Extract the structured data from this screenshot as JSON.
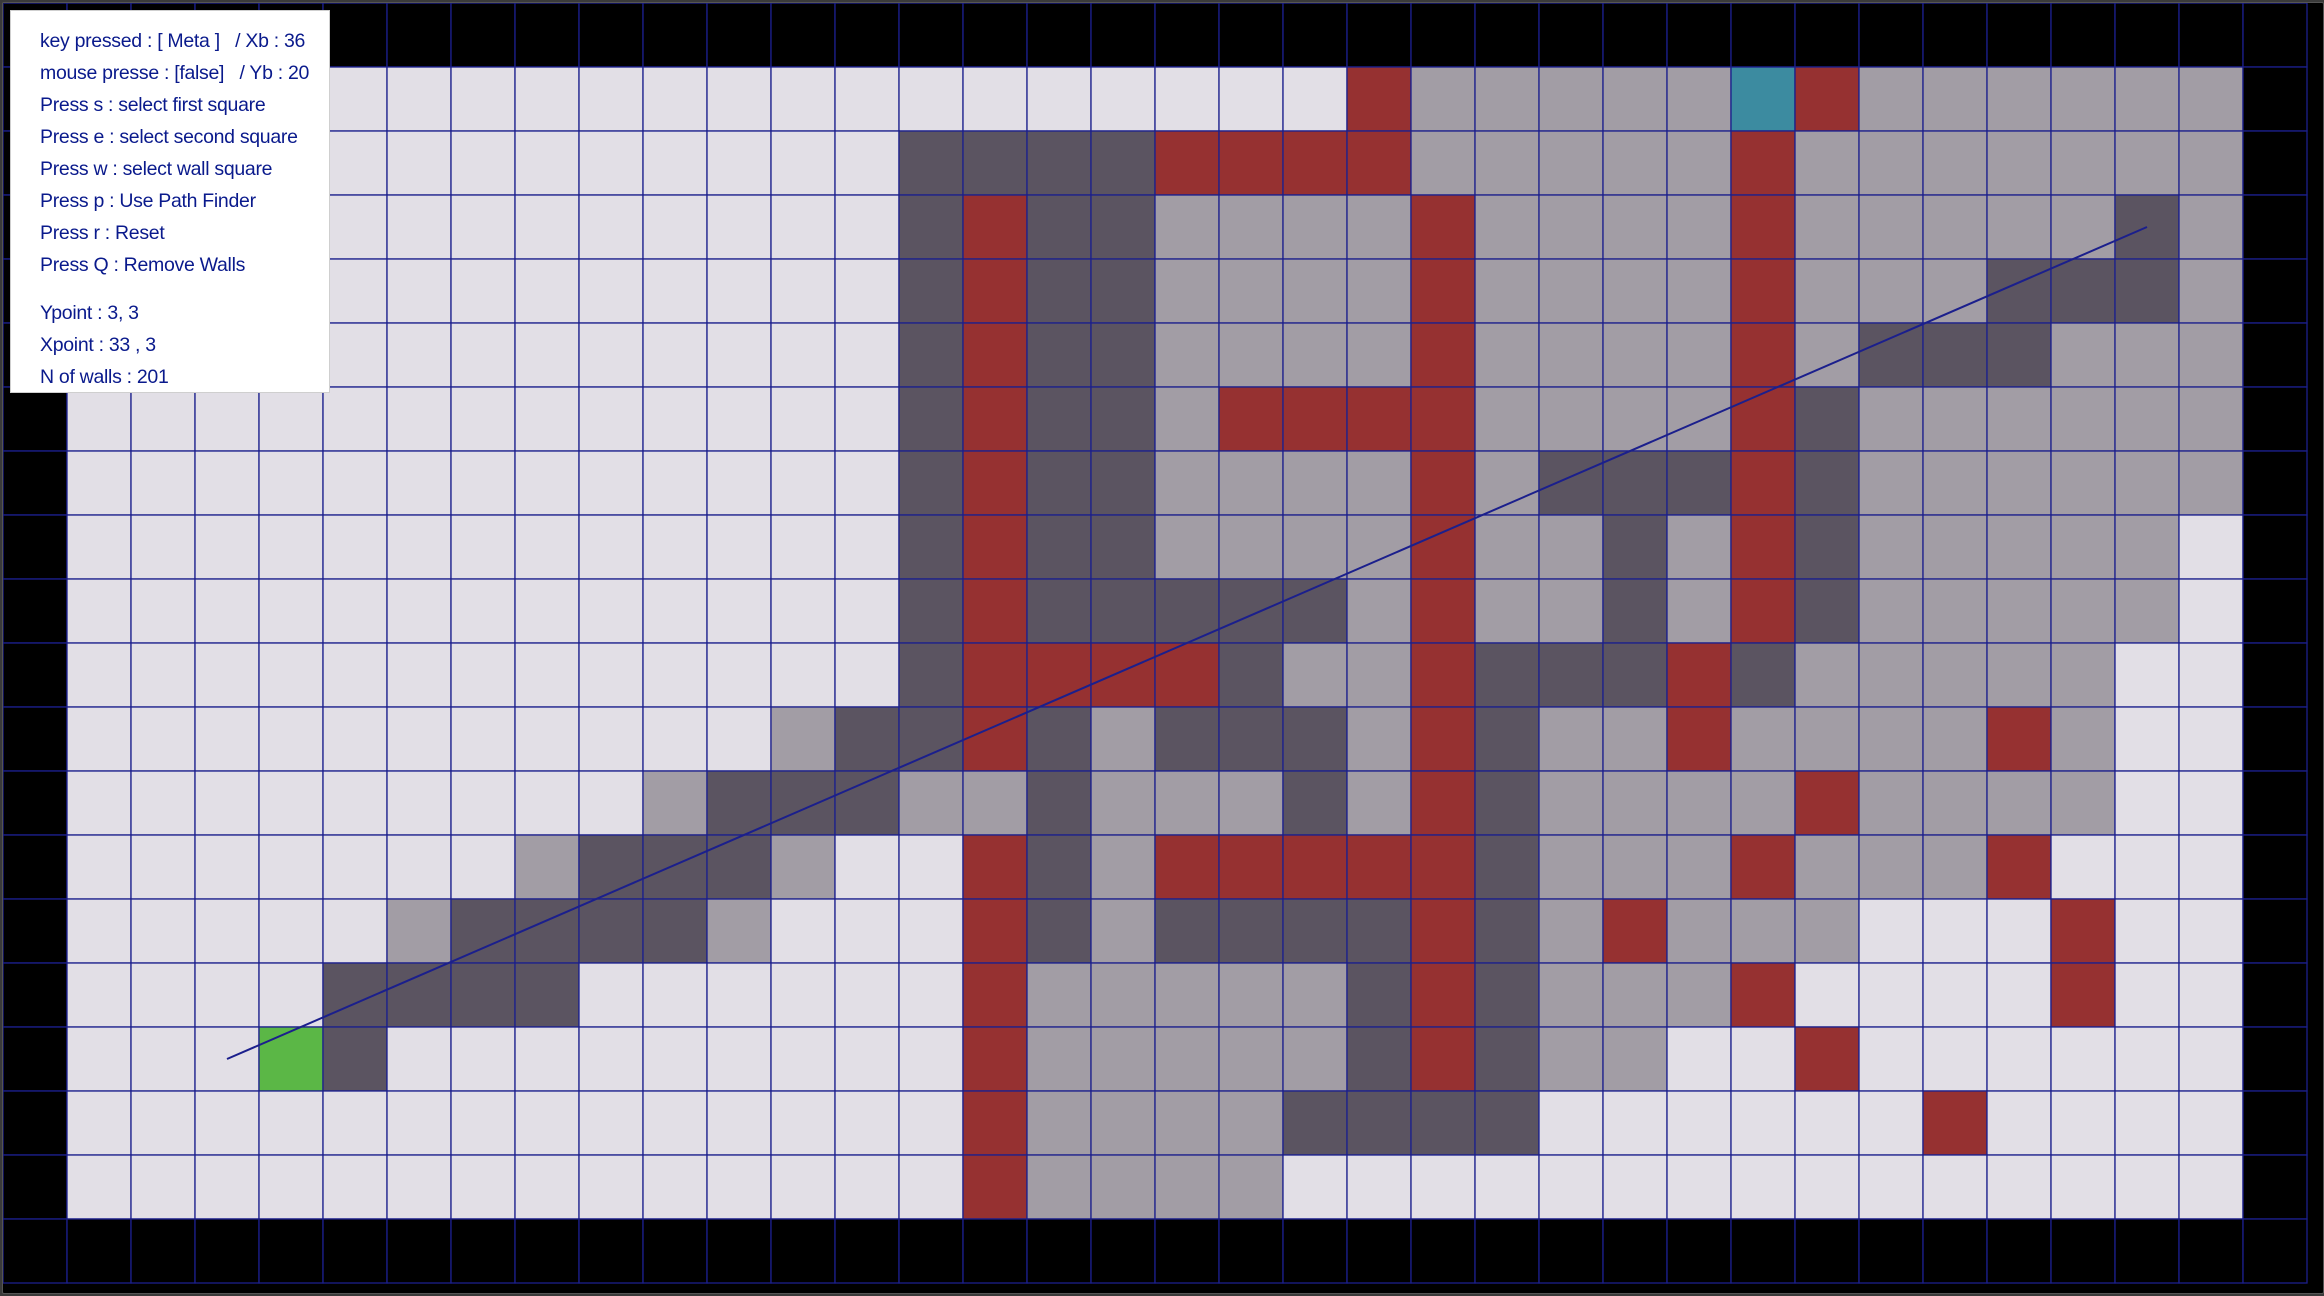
{
  "colors": {
    "outside": "#000000",
    "empty": "#e2dfe6",
    "wall": "#963131",
    "visited": "#a29da5",
    "path": "#5b5461",
    "start": "#5bb746",
    "end": "#3c8ba0",
    "gridline": "#1b1f8c",
    "sightline": "#1b1f8c"
  },
  "hud": {
    "key_pressed": "key pressed : [ Meta ]   / Xb : 36",
    "mouse_pressed": "mouse presse : [false]   / Yb : 20",
    "help_s": "Press s : select first square",
    "help_e": "Press e : select second square",
    "help_w": "Press w : select wall square",
    "help_p": "Press p : Use Path Finder",
    "help_r": "Press r : Reset",
    "help_q": "Press Q : Remove Walls",
    "ypoint": "Ypoint : 3, 3",
    "xpoint": "Xpoint : 33 , 3",
    "n_walls": "N of walls : 201"
  },
  "board": {
    "cols": 36,
    "rows": 20,
    "legend": "0 = outside, 1 = empty, 2 = wall, 3 = visited, 4 = path, 5 = start, 6 = end",
    "cells": [
      "000000000000000000000000000000000000",
      "011111111111111111111233333623333330",
      "011111111111114444222233333233333330",
      "011111111111114244333323333233333430",
      "011111111111114244333323333233344430",
      "011111111111114244333323333234443330",
      "011111111111114244322223333243333330",
      "011111111111114244333323444243333330",
      "011111111111114244333323343243333310",
      "011111111111114244444323343243333310",
      "011111111111114222243324442433333110",
      "011111111111344243444324332333323110",
      "011111111134443343334324333323333110",
      "011111113444311243222224333233321110",
      "011111344443111243444424323331112110",
      "011114444111111233333424333211112110",
      "011154111111111233333424331121111110",
      "011111111111111233334444111111211110",
      "011111111111111233331111111111111110",
      "000000000000000000000000000000000000"
    ],
    "start_cell": [
      3,
      16
    ],
    "end_cell": [
      33,
      3
    ]
  }
}
